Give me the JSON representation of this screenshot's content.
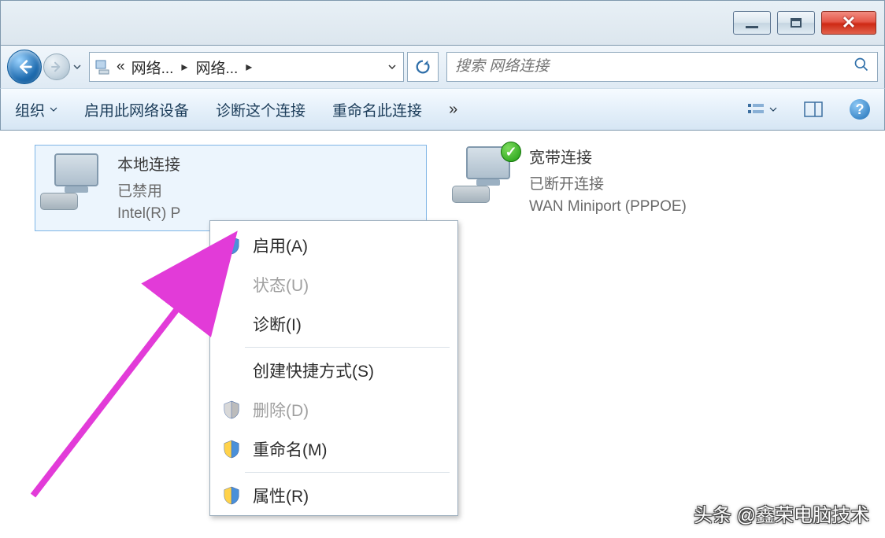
{
  "breadcrumb": {
    "prefix": "«",
    "seg1": "网络...",
    "seg2": "网络..."
  },
  "search": {
    "placeholder": "搜索 网络连接"
  },
  "toolbar": {
    "organize": "组织",
    "enable_device": "启用此网络设备",
    "diagnose": "诊断这个连接",
    "rename": "重命名此连接",
    "more": "»"
  },
  "connections": {
    "local": {
      "name": "本地连接",
      "status": "已禁用",
      "device": "Intel(R) P"
    },
    "wan": {
      "name": "宽带连接",
      "status": "已断开连接",
      "device": "WAN Miniport (PPPOE)"
    }
  },
  "contextmenu": {
    "enable": "启用(A)",
    "status": "状态(U)",
    "diagnose": "诊断(I)",
    "shortcut": "创建快捷方式(S)",
    "delete": "删除(D)",
    "rename": "重命名(M)",
    "properties": "属性(R)"
  },
  "watermark": "头条 @鑫荣电脑技术"
}
